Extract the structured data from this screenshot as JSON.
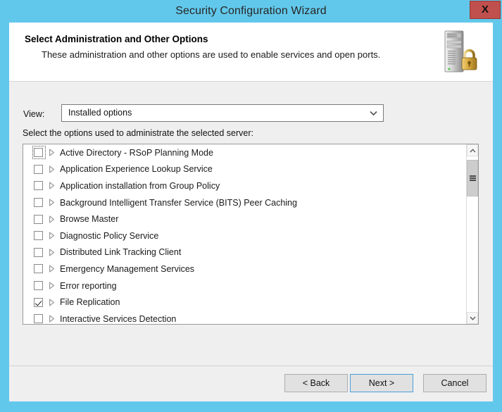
{
  "window": {
    "title": "Security Configuration Wizard",
    "close_label": "X",
    "accent_color": "#62c8eb",
    "close_color": "#c0504d"
  },
  "header": {
    "title": "Select Administration and Other Options",
    "subtitle": "These administration and other options are used to enable services and open ports.",
    "icon": "server-lock-icon"
  },
  "view": {
    "label": "View:",
    "selected": "Installed options",
    "options": [
      "Installed options"
    ],
    "arrow_icon": "chevron-down-icon"
  },
  "list": {
    "caption": "Select the options used to administrate the selected server:",
    "items": [
      {
        "label": "Active Directory - RSoP Planning Mode",
        "checked": false,
        "focused": true
      },
      {
        "label": "Application Experience Lookup Service",
        "checked": false,
        "focused": false
      },
      {
        "label": "Application installation from Group Policy",
        "checked": false,
        "focused": false
      },
      {
        "label": "Background Intelligent Transfer Service (BITS) Peer Caching",
        "checked": false,
        "focused": false
      },
      {
        "label": "Browse Master",
        "checked": false,
        "focused": false
      },
      {
        "label": "Diagnostic Policy Service",
        "checked": false,
        "focused": false
      },
      {
        "label": "Distributed Link Tracking Client",
        "checked": false,
        "focused": false
      },
      {
        "label": "Emergency Management Services",
        "checked": false,
        "focused": false
      },
      {
        "label": "Error reporting",
        "checked": false,
        "focused": false
      },
      {
        "label": "File Replication",
        "checked": true,
        "focused": false
      },
      {
        "label": "Interactive Services Detection",
        "checked": false,
        "focused": false
      }
    ],
    "scrollbar": {
      "up_icon": "chevron-up-icon",
      "down_icon": "chevron-down-icon",
      "thumb_icon": "grip-icon"
    }
  },
  "footer": {
    "back_label": "< Back",
    "next_label": "Next >",
    "cancel_label": "Cancel",
    "default_button": "Next >"
  }
}
